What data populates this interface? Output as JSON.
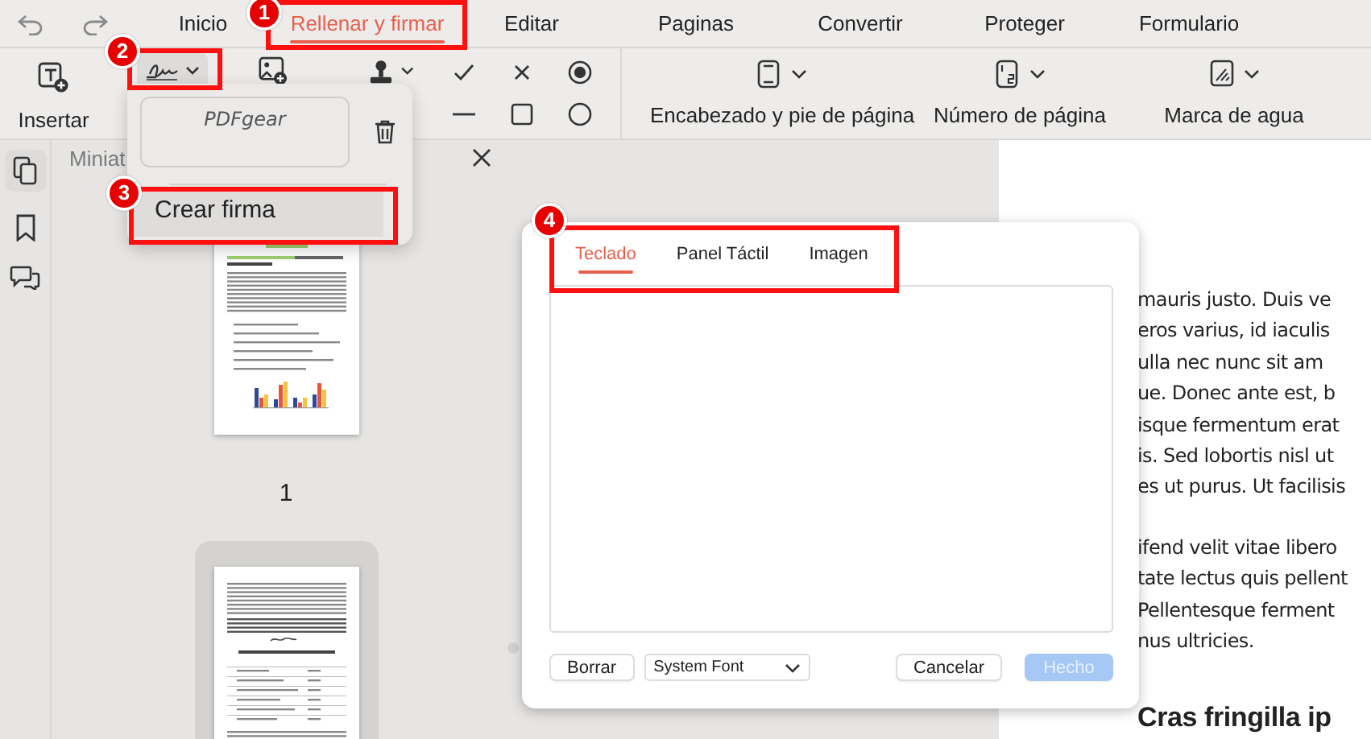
{
  "menu_tabs": [
    {
      "label": "Inicio",
      "selected": false
    },
    {
      "label": "Rellenar y firmar",
      "selected": true
    },
    {
      "label": "Editar",
      "selected": false
    },
    {
      "label": "Paginas",
      "selected": false
    },
    {
      "label": "Convertir",
      "selected": false
    },
    {
      "label": "Proteger",
      "selected": false
    },
    {
      "label": "Formulario",
      "selected": false
    }
  ],
  "toolbar": {
    "insert_label": "Insertar",
    "right_tools": [
      {
        "kind": "header",
        "label": "Encabezado y pie de página"
      },
      {
        "kind": "number",
        "label": "Número de página"
      },
      {
        "kind": "watermark",
        "label": "Marca de agua"
      }
    ]
  },
  "sidebar": {
    "panel_title": "Miniat",
    "thumbnails": [
      {
        "page_label": "1",
        "selected": false
      },
      {
        "selected": true
      }
    ]
  },
  "signature_menu": {
    "signatures": [
      "PDFgear"
    ],
    "action": "Crear firma"
  },
  "dialog": {
    "tabs": [
      {
        "label": "Teclado",
        "selected": true
      },
      {
        "label": "Panel Táctil",
        "selected": false
      },
      {
        "label": "Imagen",
        "selected": false
      }
    ],
    "clear_button": "Borrar",
    "font_select": "System Font",
    "cancel_button": "Cancelar",
    "done_button": {
      "label": "Hecho",
      "disabled": true
    }
  },
  "document": {
    "paragraphs": [
      [
        "mauris justo. Duis ve",
        "eros varius, id iaculis",
        "ulla nec nunc sit am",
        "ue. Donec ante est, b",
        "isque fermentum erat",
        "is. Sed lobortis nisl ut",
        "es ut purus. Ut facilisis"
      ],
      [
        "ifend velit vitae libero",
        "tate lectus quis pellent",
        "Pellentesque ferment",
        "nus ultricies."
      ]
    ],
    "heading": "Cras fringilla ip"
  },
  "callouts": [
    "1",
    "2",
    "3",
    "4"
  ]
}
